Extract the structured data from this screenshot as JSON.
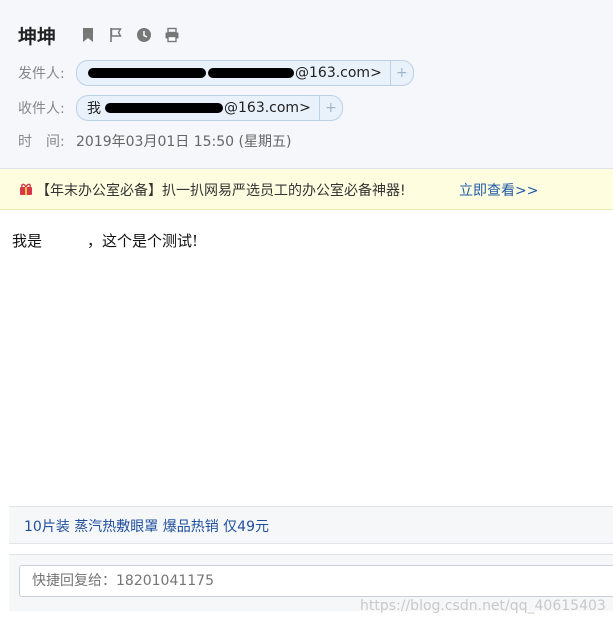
{
  "header": {
    "title": "坤坤",
    "tools": [
      "bookmark-icon",
      "flag-icon",
      "clock-icon",
      "print-icon"
    ]
  },
  "from": {
    "label": "发件人:",
    "email_suffix": "@163.com>",
    "add_label": "+"
  },
  "to": {
    "label": "收件人:",
    "name_start": "我",
    "email_suffix": "@163.com>",
    "add_label": "+"
  },
  "date": {
    "label": "时　间:",
    "value": "2019年03月01日 15:50 (星期五)"
  },
  "promo": {
    "icon": "gift-icon",
    "text": "【年末办公室必备】扒一扒网易严选员工的办公室必备神器!",
    "link": "立即查看>>"
  },
  "body": {
    "text": "我是　　　，这个是个测试!"
  },
  "ad": {
    "text": "10片装 蒸汽热敷眼罩 爆品热销 仅49元"
  },
  "reply": {
    "placeholder": "快捷回复给：18201041175"
  },
  "watermark": "https://blog.csdn.net/qq_40615403",
  "colors": {
    "link": "#1f5aa8",
    "chip_bg": "#e9f1fa",
    "promo_bg": "#fffde0"
  }
}
